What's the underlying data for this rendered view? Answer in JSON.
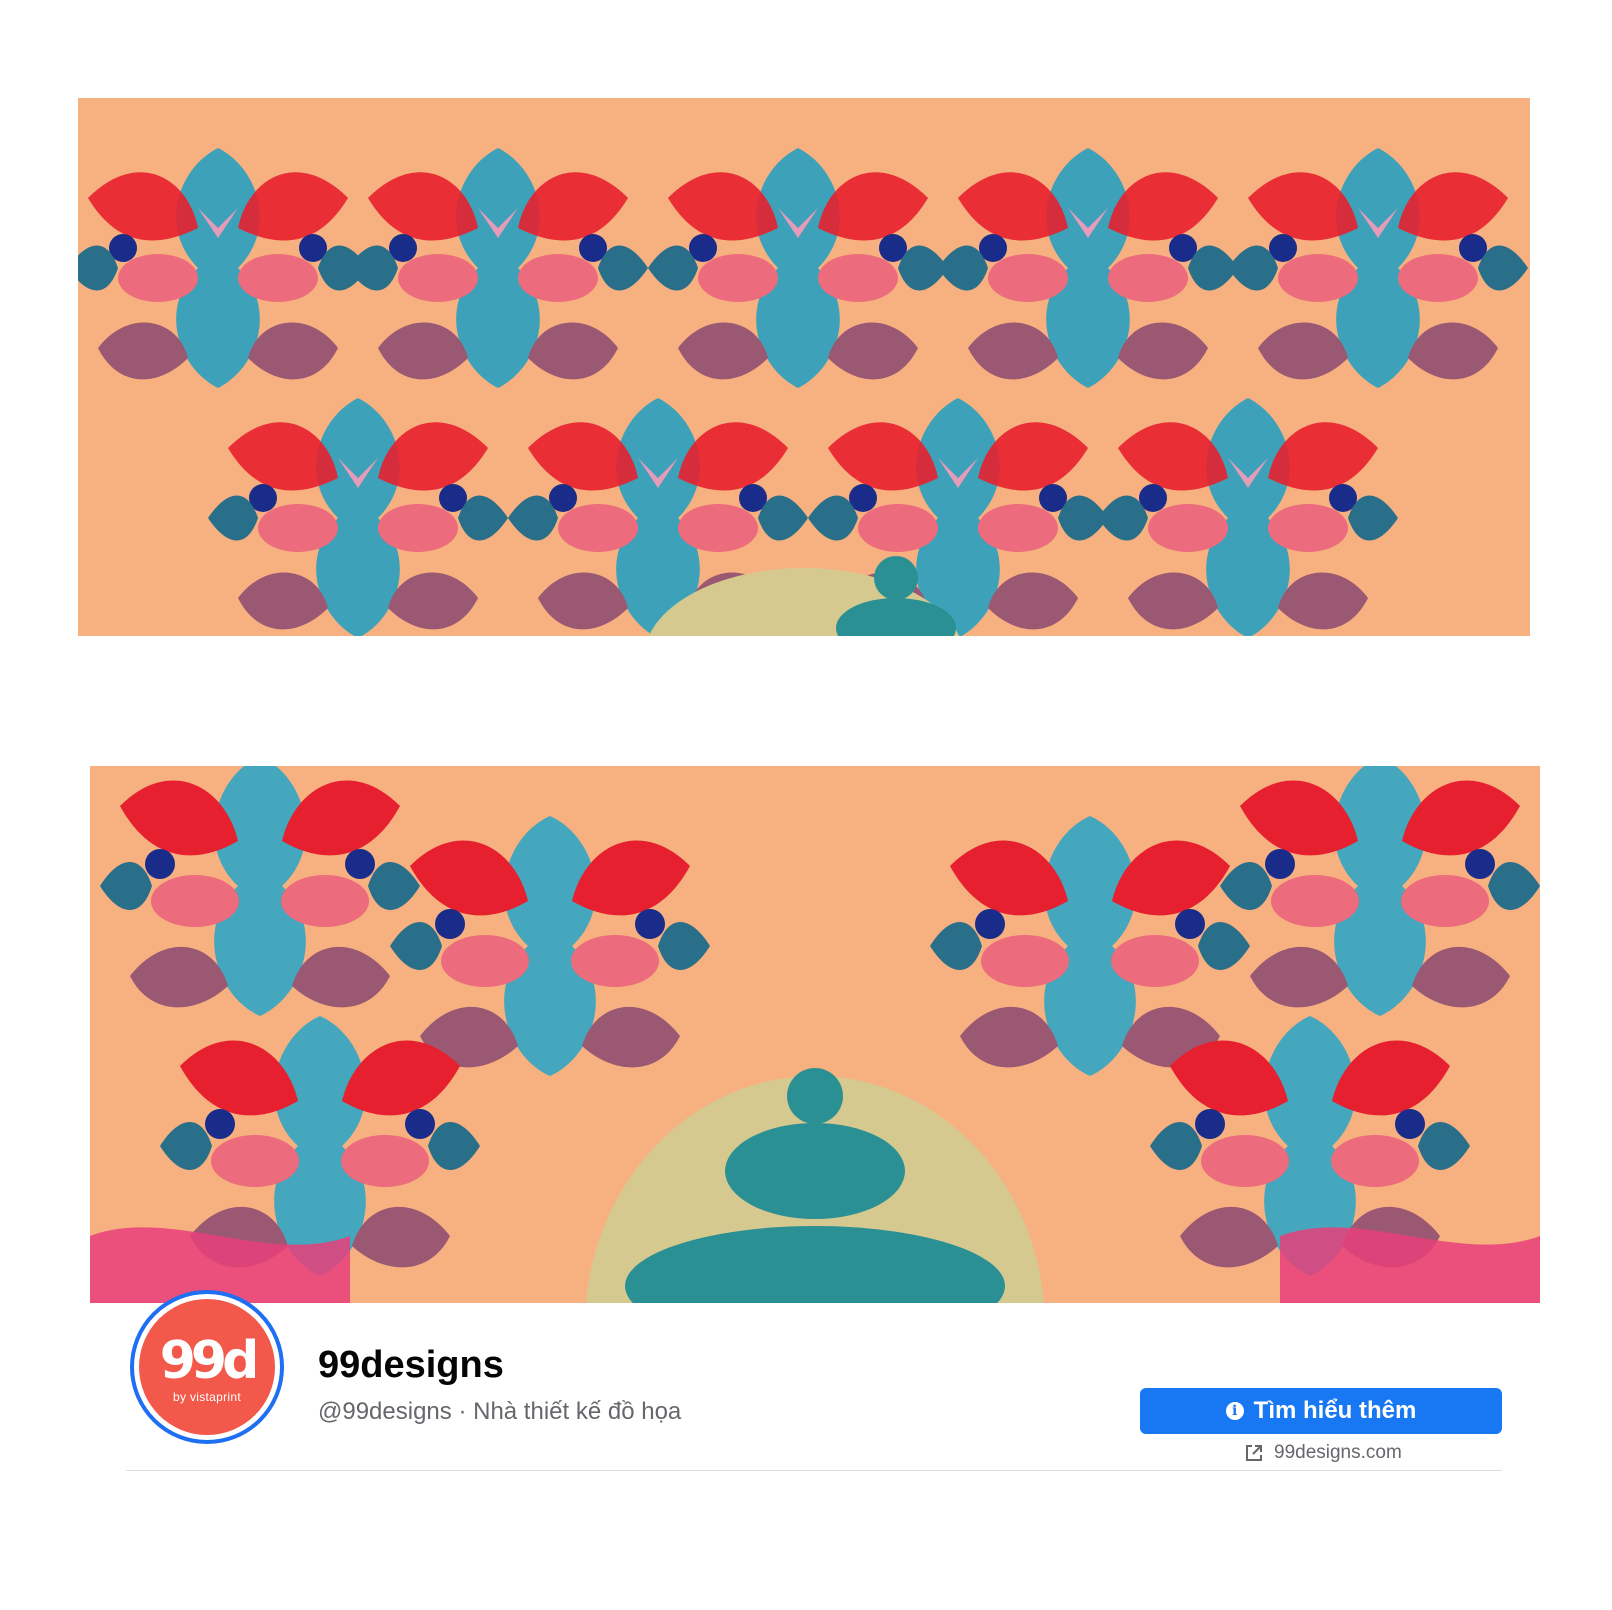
{
  "page": {
    "name": "99designs",
    "meta": "@99designs · Nhà thiết kế đồ họa"
  },
  "avatar": {
    "logo_text": "99d",
    "sub_text": "by vistaprint"
  },
  "cta": {
    "label": "Tìm hiểu thêm",
    "info_icon": "i"
  },
  "website": {
    "label": "99designs.com"
  },
  "colors": {
    "primary_blue": "#1877f2",
    "avatar_red": "#f2594b",
    "ring_blue": "#1e6ff1",
    "banner_peach": "#f7b07f"
  },
  "icons": [
    "info-icon",
    "external-link-icon"
  ]
}
